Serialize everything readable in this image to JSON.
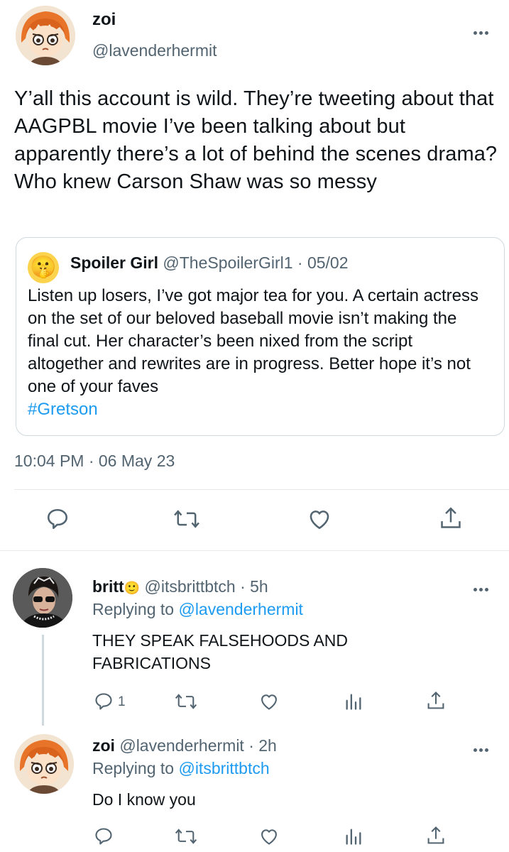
{
  "main_tweet": {
    "author_name": "zoi",
    "author_handle": "@lavenderhermit",
    "text": "Y’all this account is wild. They’re tweeting about that AAGPBL movie I’ve been talking about but apparently there’s a lot of behind the scenes drama? Who knew Carson Shaw was so messy",
    "timestamp": "10:04 PM · 06 May 23",
    "quoted": {
      "author_name": "Spoiler Girl",
      "author_handle": "@TheSpoilerGirl1",
      "date": "· 05/02",
      "avatar_emoji": "🤫",
      "text": "Listen up losers, I’ve got major tea for you. A certain actress on the set of our beloved baseball movie isn’t making the final cut. Her character’s been nixed from the script altogether and rewrites are in progress. Better hope it’s not one of your faves",
      "hashtag": "#Gretson"
    },
    "actions": [
      "reply-icon",
      "retweet-icon",
      "like-icon",
      "share-icon"
    ]
  },
  "replies": [
    {
      "author_name": "britt",
      "name_emoji": "🙂",
      "author_handle": "@itsbrittbtch",
      "age": "· 5h",
      "replying_prefix": "Replying to",
      "replying_to": "@lavenderhermit",
      "text": "THEY SPEAK FALSEHOODS AND FABRICATIONS",
      "reply_count": "1"
    },
    {
      "author_name": "zoi",
      "author_handle": "@lavenderhermit",
      "age": "· 2h",
      "replying_prefix": "Replying to",
      "replying_to": "@itsbrittbtch",
      "text": "Do I know you"
    }
  ],
  "colors": {
    "accent": "#1d9bf0",
    "muted": "#536471",
    "border": "#cfd9de",
    "zoi_hair": "#e8742a"
  }
}
